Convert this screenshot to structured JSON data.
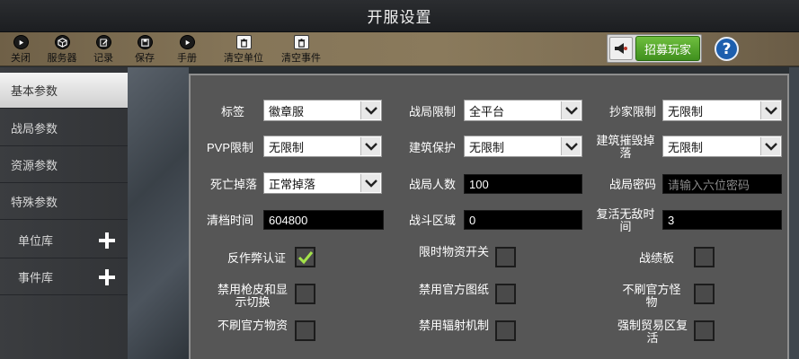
{
  "window": {
    "title": "开服设置"
  },
  "toolbar": {
    "close": "关闭",
    "server": "服务器",
    "record": "记录",
    "save": "保存",
    "manual": "手册",
    "clear_units": "清空单位",
    "clear_events": "清空事件",
    "recruit": "招募玩家",
    "help": "?"
  },
  "sidebar": {
    "items": [
      "基本参数",
      "战局参数",
      "资源参数",
      "特殊参数",
      "单位库",
      "事件库"
    ],
    "active_index": 0
  },
  "form": {
    "tag": {
      "label": "标签",
      "value": "徽章服"
    },
    "battle_limit": {
      "label": "战局限制",
      "value": "全平台"
    },
    "raid_limit": {
      "label": "抄家限制",
      "value": "无限制"
    },
    "pvp_limit": {
      "label": "PVP限制",
      "value": "无限制"
    },
    "build_protect": {
      "label": "建筑保护",
      "value": "无限制"
    },
    "build_destroy": {
      "label": "建筑摧毁掉落",
      "value": "无限制"
    },
    "death_drop": {
      "label": "死亡掉落",
      "value": "正常掉落"
    },
    "battle_players": {
      "label": "战局人数",
      "value": "100"
    },
    "battle_password": {
      "label": "战局密码",
      "placeholder": "请输入六位密码"
    },
    "clear_time": {
      "label": "清档时间",
      "value": "604800"
    },
    "battle_region": {
      "label": "战斗区域",
      "value": "0"
    },
    "respawn_invuln": {
      "label": "复活无敌时间",
      "value": "3"
    },
    "checks": [
      {
        "label": "反作弊认证",
        "checked": true
      },
      {
        "label": "限时物资开关",
        "checked": false
      },
      {
        "label": "战绩板",
        "checked": false
      },
      {
        "label": "禁用枪皮和显示切换",
        "checked": false
      },
      {
        "label": "禁用官方图纸",
        "checked": false
      },
      {
        "label": "不刷官方怪物",
        "checked": false
      },
      {
        "label": "不刷官方物资",
        "checked": false
      },
      {
        "label": "禁用辐射机制",
        "checked": false
      },
      {
        "label": "强制贸易区复活",
        "checked": false
      }
    ]
  },
  "colors": {
    "check": "#a4e34a",
    "recruit": "#4fa52a",
    "help": "#1d5fae"
  }
}
